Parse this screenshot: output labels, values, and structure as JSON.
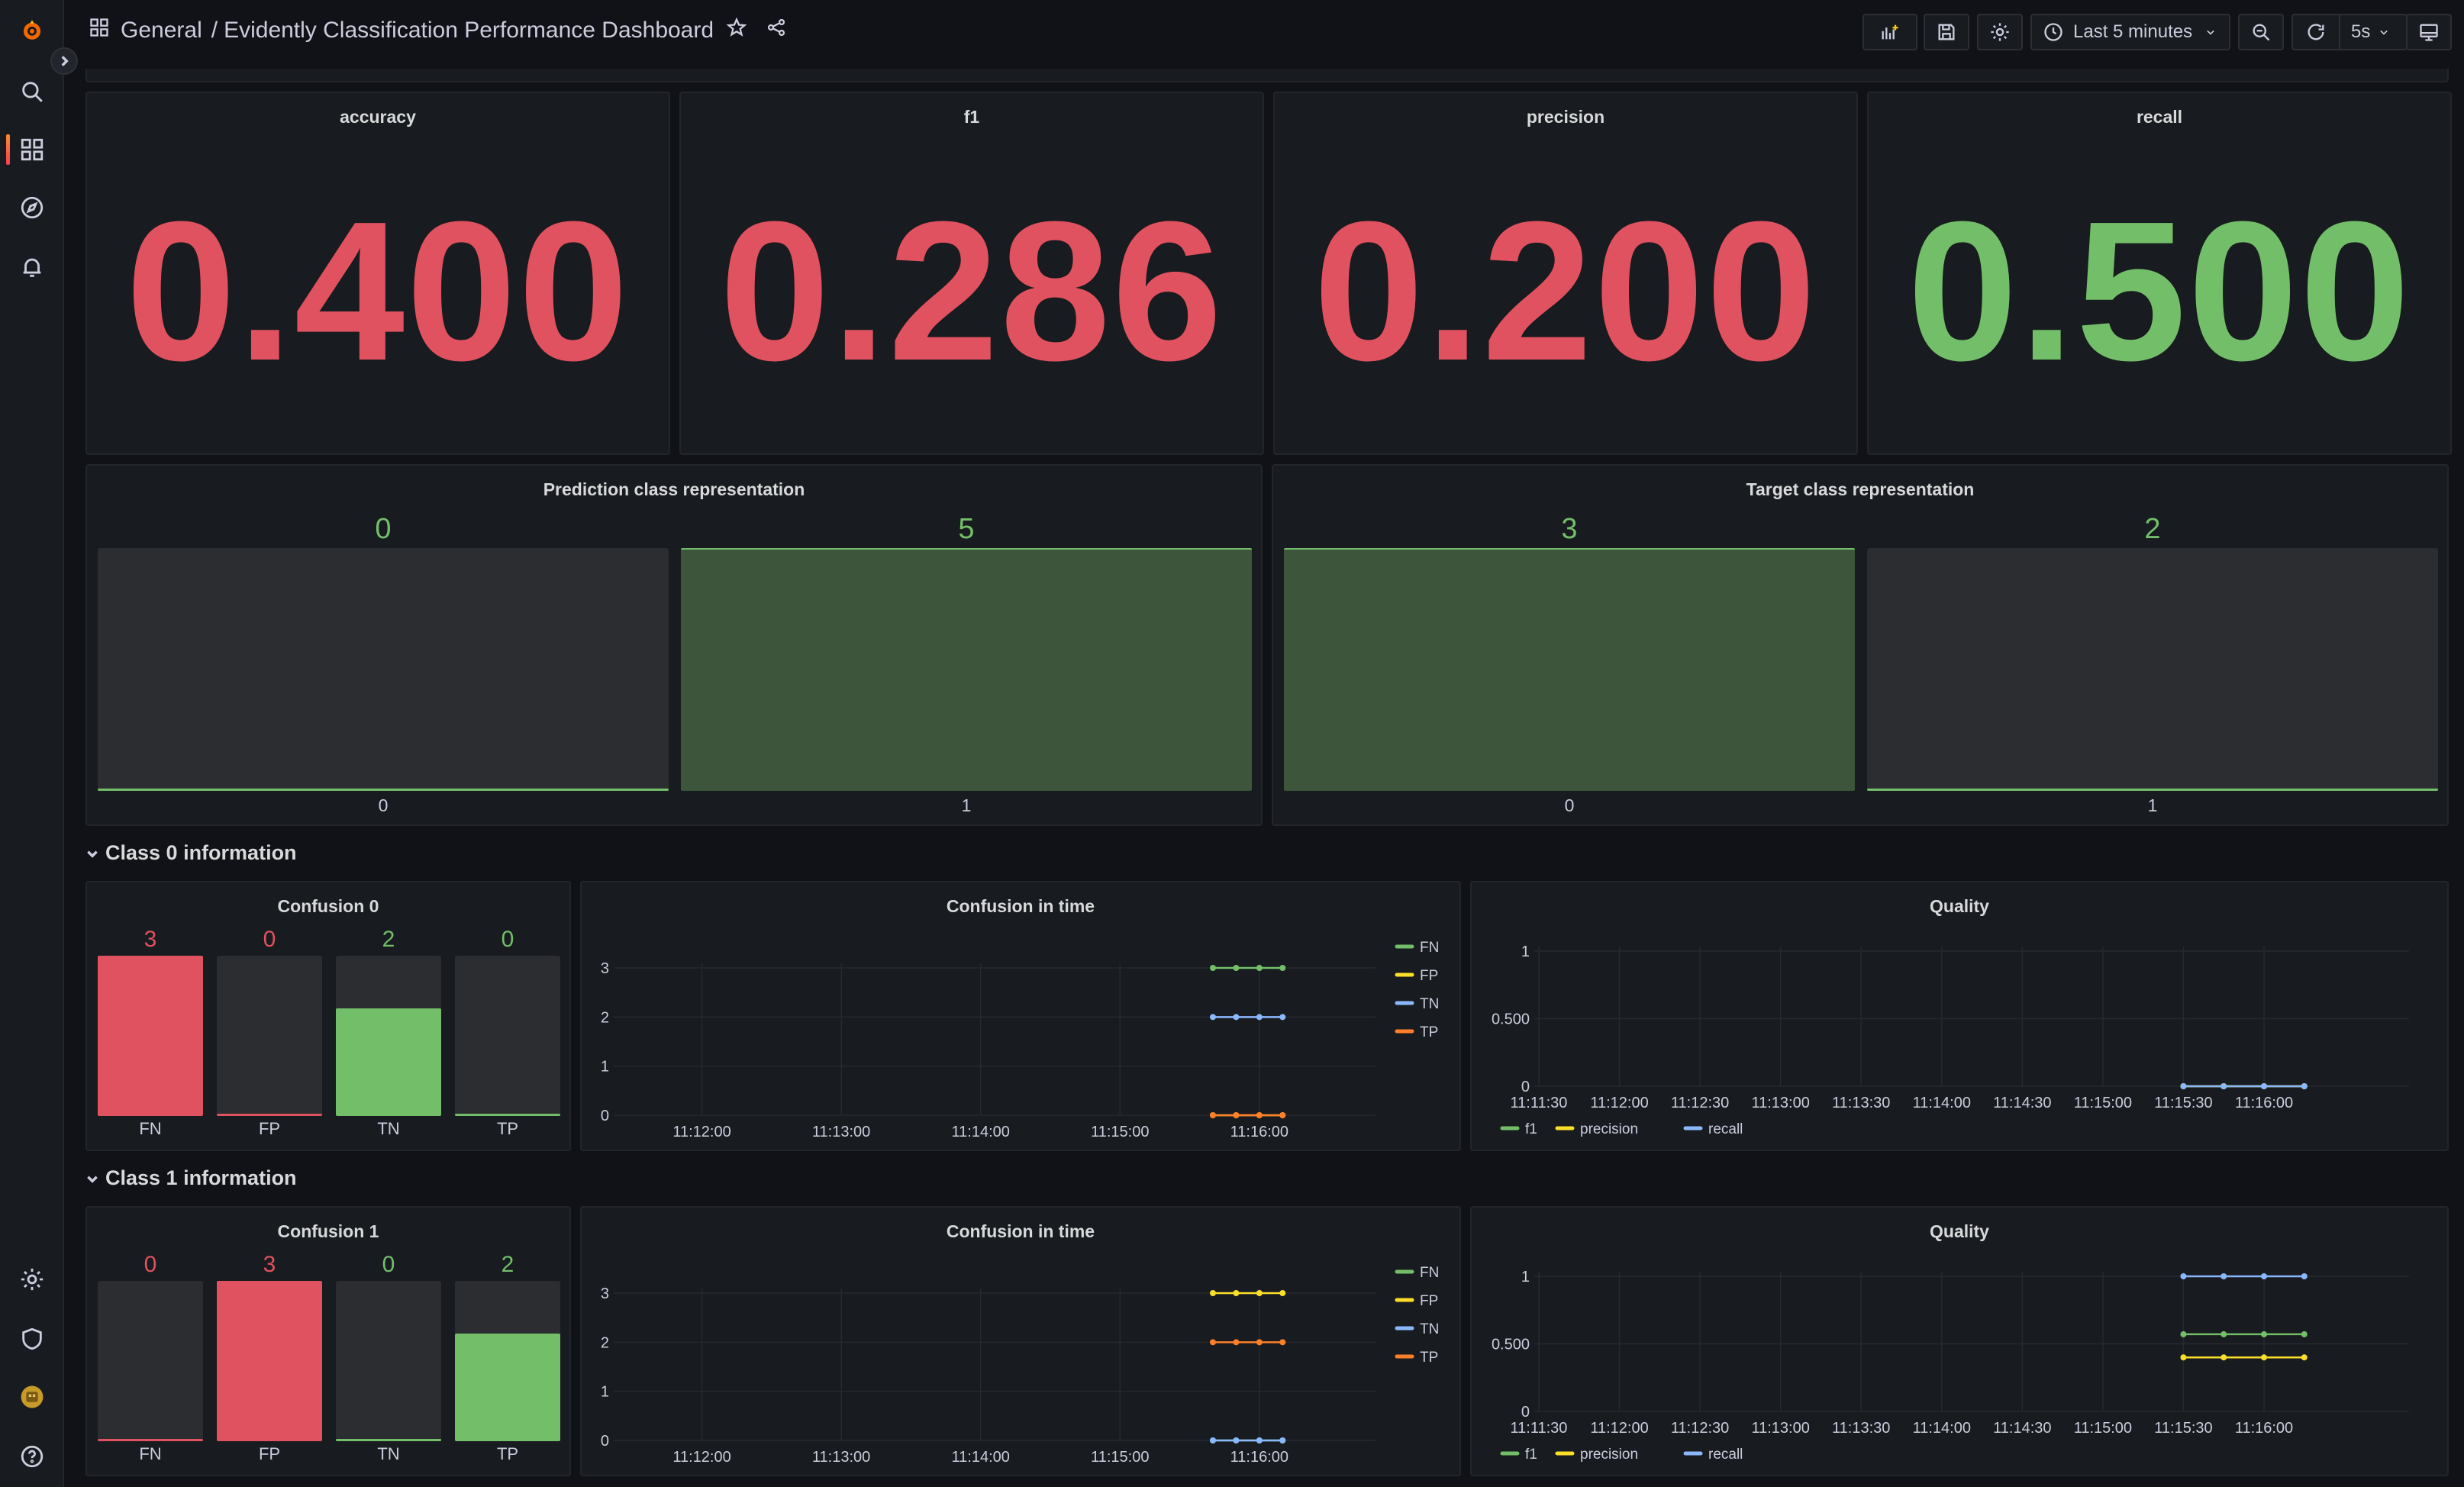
{
  "breadcrumb": {
    "folder": "General",
    "separator": "/",
    "title": "Evidently Classification Performance Dashboard"
  },
  "toolbar": {
    "time_range": "Last 5 minutes",
    "refresh_interval": "5s"
  },
  "stats": [
    {
      "title": "accuracy",
      "value": "0.400",
      "color": "#e0525f"
    },
    {
      "title": "f1",
      "value": "0.286",
      "color": "#e0525f"
    },
    {
      "title": "precision",
      "value": "0.200",
      "color": "#e0525f"
    },
    {
      "title": "recall",
      "value": "0.500",
      "color": "#73bf69"
    }
  ],
  "prediction_panel": {
    "title": "Prediction class representation",
    "bars": [
      {
        "label": "0",
        "value": "0",
        "level": 0
      },
      {
        "label": "1",
        "value": "5",
        "level": 1
      }
    ]
  },
  "target_panel": {
    "title": "Target class representation",
    "bars": [
      {
        "label": "0",
        "value": "3",
        "level": 1
      },
      {
        "label": "1",
        "value": "2",
        "level": 0
      }
    ]
  },
  "rows": [
    {
      "title": "Class 0 information"
    },
    {
      "title": "Class 1 information"
    }
  ],
  "confusion": [
    {
      "title": "Confusion 0",
      "bars": [
        {
          "label": "FN",
          "value": "3",
          "level": 1,
          "color": "#e0525f",
          "value_color": "#e0525f"
        },
        {
          "label": "FP",
          "value": "0",
          "level": 0,
          "color": "#e0525f",
          "value_color": "#e0525f"
        },
        {
          "label": "TN",
          "value": "2",
          "level": 0.67,
          "color": "#73bf69",
          "value_color": "#73bf69"
        },
        {
          "label": "TP",
          "value": "0",
          "level": 0,
          "color": "#73bf69",
          "value_color": "#73bf69"
        }
      ]
    },
    {
      "title": "Confusion 1",
      "bars": [
        {
          "label": "FN",
          "value": "0",
          "level": 0,
          "color": "#e0525f",
          "value_color": "#e0525f"
        },
        {
          "label": "FP",
          "value": "3",
          "level": 1,
          "color": "#e0525f",
          "value_color": "#e0525f"
        },
        {
          "label": "TN",
          "value": "0",
          "level": 0,
          "color": "#73bf69",
          "value_color": "#73bf69"
        },
        {
          "label": "TP",
          "value": "2",
          "level": 0.67,
          "color": "#73bf69",
          "value_color": "#73bf69"
        }
      ]
    }
  ],
  "timeseries_titles": {
    "confusion": "Confusion in time",
    "quality": "Quality"
  },
  "chart_data": [
    {
      "type": "line",
      "title": "Confusion in time",
      "panel": "class0",
      "x": [
        "11:15:40",
        "11:15:50",
        "11:16:00",
        "11:16:10"
      ],
      "xticks": [
        "11:12:00",
        "11:13:00",
        "11:14:00",
        "11:15:00",
        "11:16:00"
      ],
      "yticks": [
        "0",
        "1",
        "2",
        "3"
      ],
      "ylim": [
        0,
        3
      ],
      "legend_position": "right",
      "series": [
        {
          "name": "FN",
          "color": "#73bf69",
          "values": [
            3,
            3,
            3,
            3
          ]
        },
        {
          "name": "FP",
          "color": "#fade2a",
          "values": [
            0,
            0,
            0,
            0
          ]
        },
        {
          "name": "TN",
          "color": "#8ab8ff",
          "values": [
            2,
            2,
            2,
            2
          ]
        },
        {
          "name": "TP",
          "color": "#ff7f2a",
          "values": [
            0,
            0,
            0,
            0
          ]
        }
      ]
    },
    {
      "type": "line",
      "title": "Quality",
      "panel": "class0",
      "x": [
        "11:15:30",
        "11:15:45",
        "11:16:00",
        "11:16:15"
      ],
      "xticks": [
        "11:11:30",
        "11:12:00",
        "11:12:30",
        "11:13:00",
        "11:13:30",
        "11:14:00",
        "11:14:30",
        "11:15:00",
        "11:15:30",
        "11:16:00"
      ],
      "yticks": [
        "0",
        "0.500",
        "1"
      ],
      "ylim": [
        0,
        1
      ],
      "legend_position": "bottom",
      "series": [
        {
          "name": "f1",
          "color": "#73bf69",
          "values": [
            0,
            0,
            0,
            0
          ]
        },
        {
          "name": "precision",
          "color": "#fade2a",
          "values": [
            0,
            0,
            0,
            0
          ]
        },
        {
          "name": "recall",
          "color": "#8ab8ff",
          "values": [
            0,
            0,
            0,
            0
          ]
        }
      ]
    },
    {
      "type": "line",
      "title": "Confusion in time",
      "panel": "class1",
      "x": [
        "11:15:40",
        "11:15:50",
        "11:16:00",
        "11:16:10"
      ],
      "xticks": [
        "11:12:00",
        "11:13:00",
        "11:14:00",
        "11:15:00",
        "11:16:00"
      ],
      "yticks": [
        "0",
        "1",
        "2",
        "3"
      ],
      "ylim": [
        0,
        3
      ],
      "legend_position": "right",
      "series": [
        {
          "name": "FN",
          "color": "#73bf69",
          "values": [
            0,
            0,
            0,
            0
          ]
        },
        {
          "name": "FP",
          "color": "#fade2a",
          "values": [
            3,
            3,
            3,
            3
          ]
        },
        {
          "name": "TN",
          "color": "#8ab8ff",
          "values": [
            0,
            0,
            0,
            0
          ]
        },
        {
          "name": "TP",
          "color": "#ff7f2a",
          "values": [
            2,
            2,
            2,
            2
          ]
        }
      ]
    },
    {
      "type": "line",
      "title": "Quality",
      "panel": "class1",
      "x": [
        "11:15:30",
        "11:15:45",
        "11:16:00",
        "11:16:15"
      ],
      "xticks": [
        "11:11:30",
        "11:12:00",
        "11:12:30",
        "11:13:00",
        "11:13:30",
        "11:14:00",
        "11:14:30",
        "11:15:00",
        "11:15:30",
        "11:16:00"
      ],
      "yticks": [
        "0",
        "0.500",
        "1"
      ],
      "ylim": [
        0,
        1
      ],
      "legend_position": "bottom",
      "series": [
        {
          "name": "f1",
          "color": "#73bf69",
          "values": [
            0.571,
            0.571,
            0.571,
            0.571
          ]
        },
        {
          "name": "precision",
          "color": "#fade2a",
          "values": [
            0.4,
            0.4,
            0.4,
            0.4
          ]
        },
        {
          "name": "recall",
          "color": "#8ab8ff",
          "values": [
            1,
            1,
            1,
            1
          ]
        }
      ]
    }
  ]
}
